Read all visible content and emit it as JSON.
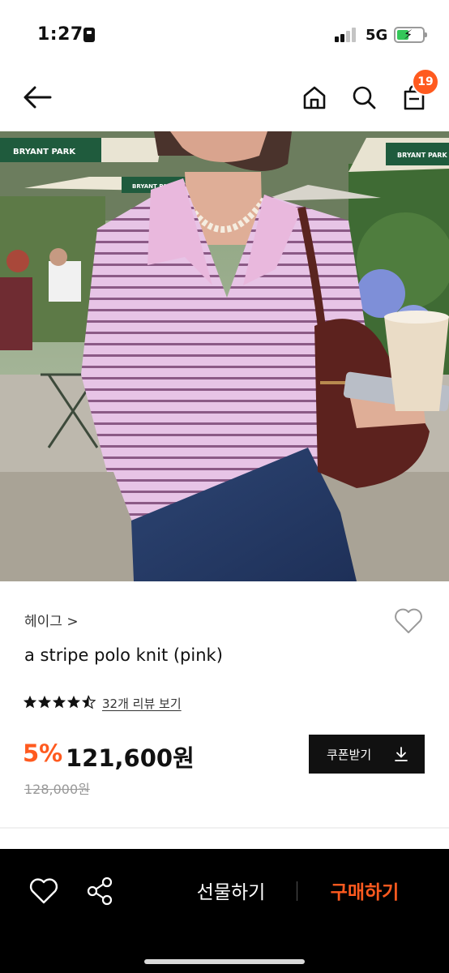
{
  "status_bar": {
    "time": "1:27",
    "network": "5G"
  },
  "header": {
    "cart_count": "19",
    "icons": [
      "back-arrow-icon",
      "home-icon",
      "search-icon",
      "shopping-bag-icon"
    ]
  },
  "product_image": {
    "signs": [
      "BRYANT PARK",
      "BRYANT PARK",
      "BRYANT PARK"
    ]
  },
  "product": {
    "brand": "헤이그 >",
    "name": "a stripe polo knit (pink)",
    "rating": 4.5,
    "reviews_label": "32개 리뷰 보기",
    "discount": "5%",
    "price": "121,600원",
    "original_price": "128,000원",
    "coupon_label": "쿠폰받기"
  },
  "bottom_bar": {
    "gift_label": "선물하기",
    "buy_label": "구매하기"
  },
  "colors": {
    "accent": "#ff5a1f",
    "bottom_bar_bg": "#000000",
    "coupon_bg": "#111111"
  }
}
